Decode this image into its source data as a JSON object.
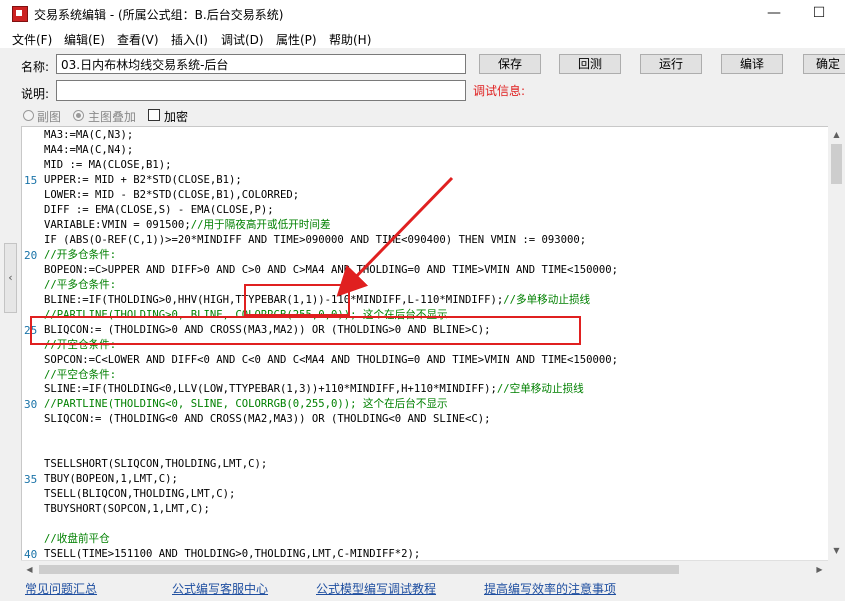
{
  "window": {
    "title": "交易系统编辑 - (所属公式组：B.后台交易系统)",
    "minimize_glyph": "—",
    "maximize_glyph": "☐"
  },
  "menu": [
    "文件(F)",
    "编辑(E)",
    "查看(V)",
    "插入(I)",
    "调试(D)",
    "属性(P)",
    "帮助(H)"
  ],
  "form": {
    "name_label": "名称:",
    "name_value": "03.日内布林均线交易系统-后台",
    "desc_label": "说明:",
    "desc_value": "",
    "debug_label": "调试信息:"
  },
  "buttons": {
    "save": "保存",
    "restore": "回测",
    "run": "运行",
    "compile": "编译",
    "confirm": "确定"
  },
  "options": {
    "sub_chart": "副图",
    "main_overlay": "主图叠加",
    "main_overlay_selected": true,
    "encrypt": "加密",
    "encrypt_checked": false
  },
  "code": [
    {
      "ln": "",
      "text": "MA3:=MA(C,N3);"
    },
    {
      "ln": "",
      "text": "MA4:=MA(C,N4);"
    },
    {
      "ln": "",
      "text": "MID := MA(CLOSE,B1);"
    },
    {
      "ln": "15",
      "text": "UPPER:= MID + B2*STD(CLOSE,B1);"
    },
    {
      "ln": "",
      "text": "LOWER:= MID - B2*STD(CLOSE,B1),COLORRED;"
    },
    {
      "ln": "",
      "text": "DIFF := EMA(CLOSE,S) - EMA(CLOSE,P);"
    },
    {
      "ln": "",
      "text": "VARIABLE:VMIN = 091500;//用于隔夜高开或低开时间差"
    },
    {
      "ln": "",
      "text": "IF (ABS(O-REF(C,1))>=20*MINDIFF AND TIME>090000 AND TIME<090400) THEN VMIN := 093000;"
    },
    {
      "ln": "20",
      "text": "//开多仓条件:"
    },
    {
      "ln": "",
      "text": "BOPEON:=C>UPPER AND DIFF>0 AND C>0 AND C>MA4 AND THOLDING=0 AND TIME>VMIN AND TIME<150000;"
    },
    {
      "ln": "",
      "text": "//平多仓条件:"
    },
    {
      "ln": "",
      "text": "BLINE:=IF(THOLDING>0,HHV(HIGH,TTYPEBAR(1,1))-110*MINDIFF,L-110*MINDIFF);//多单移动止损线"
    },
    {
      "ln": "",
      "text": "//PARTLINE(THOLDING>0, BLINE, COLORRGB(255,0,0)); 这个在后台不显示"
    },
    {
      "ln": "25",
      "text": "BLIQCON:= (THOLDING>0 AND CROSS(MA3,MA2)) OR (THOLDING>0 AND BLINE>C);"
    },
    {
      "ln": "",
      "text": "//开空仓条件:"
    },
    {
      "ln": "",
      "text": "SOPCON:=C<LOWER AND DIFF<0 AND C<0 AND C<MA4 AND THOLDING=0 AND TIME>VMIN AND TIME<150000;"
    },
    {
      "ln": "",
      "text": "//平空仓条件:"
    },
    {
      "ln": "",
      "text": "SLINE:=IF(THOLDING<0,LLV(LOW,TTYPEBAR(1,3))+110*MINDIFF,H+110*MINDIFF);//空单移动止损线"
    },
    {
      "ln": "30",
      "text": "//PARTLINE(THOLDING<0, SLINE, COLORRGB(0,255,0)); 这个在后台不显示"
    },
    {
      "ln": "",
      "text": "SLIQCON:= (THOLDING<0 AND CROSS(MA2,MA3)) OR (THOLDING<0 AND SLINE<C);"
    },
    {
      "ln": "",
      "text": ""
    },
    {
      "ln": "",
      "text": ""
    },
    {
      "ln": "",
      "text": "TSELLSHORT(SLIQCON,THOLDING,LMT,C);"
    },
    {
      "ln": "35",
      "text": "TBUY(BOPEON,1,LMT,C);"
    },
    {
      "ln": "",
      "text": "TSELL(BLIQCON,THOLDING,LMT,C);"
    },
    {
      "ln": "",
      "text": "TBUYSHORT(SOPCON,1,LMT,C);"
    },
    {
      "ln": "",
      "text": ""
    },
    {
      "ln": "",
      "text": "//收盘前平仓"
    },
    {
      "ln": "40",
      "text": "TSELL(TIME>151100 AND THOLDING>0,THOLDING,LMT,C-MINDIFF*2);"
    }
  ],
  "footer_links": [
    "常见问题汇总",
    "公式编写客服中心",
    "公式模型编写调试教程",
    "提高编写效率的注意事项"
  ],
  "colors": {
    "annotation": "#e02020",
    "line_number": "#1a73a8",
    "link": "#1f4fa0"
  }
}
